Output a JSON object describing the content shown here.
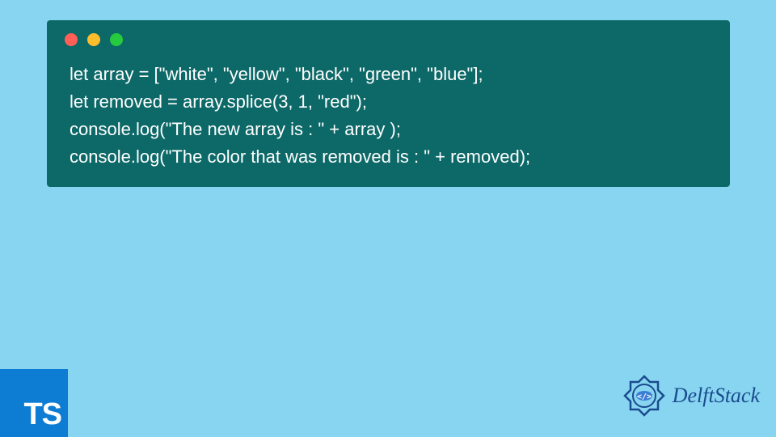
{
  "code": {
    "lines": [
      "let array = [\"white\", \"yellow\", \"black\", \"green\", \"blue\"];",
      "let removed = array.splice(3, 1, \"red\");",
      "console.log(\"The new array is : \" + array );",
      "console.log(\"The color that was removed is : \" + removed);"
    ]
  },
  "badges": {
    "typescript": "TS",
    "brand": "DelftStack"
  },
  "colors": {
    "background": "#87d5f0",
    "codeWindow": "#0d6968",
    "typescriptBadge": "#0d7dd4",
    "brandText": "#1a4b8e"
  }
}
